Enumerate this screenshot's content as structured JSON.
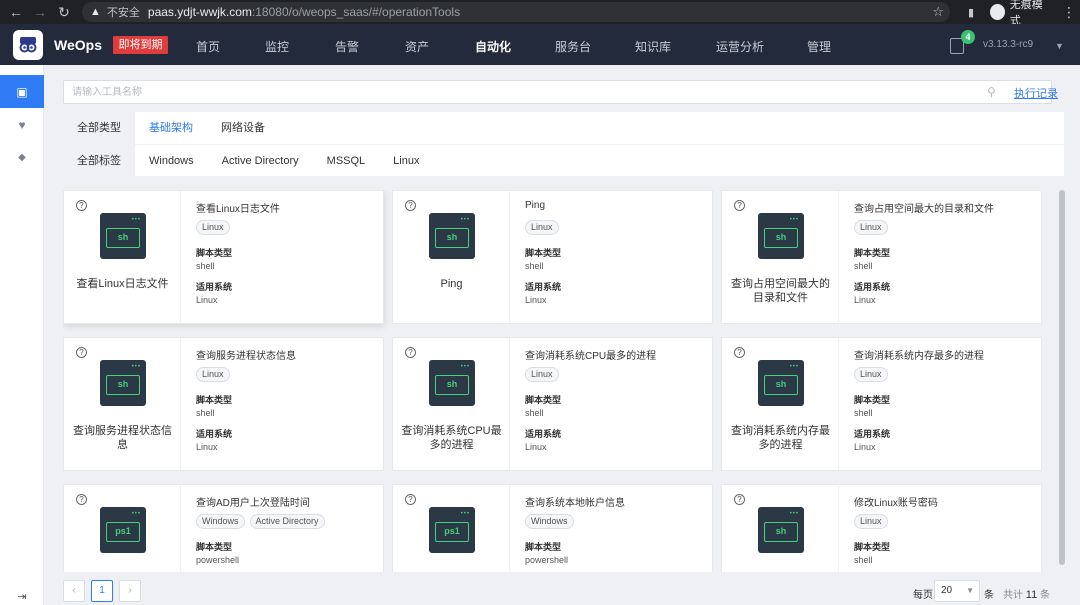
{
  "browser": {
    "back_icon": "arrow-left-icon",
    "forward_icon": "arrow-right-icon",
    "reload_icon": "reload-icon",
    "insecure_label": "不安全",
    "url_host": "paas.ydjt-wwjk.com",
    "url_path": ":18080/o/weops_saas/#/operationTools",
    "incognito_label": "无痕模式"
  },
  "header": {
    "brand": "WeOps",
    "expire_badge": "即将到期",
    "nav": [
      "首页",
      "监控",
      "告警",
      "资产",
      "自动化",
      "服务台",
      "知识库",
      "运营分析",
      "管理"
    ],
    "active_nav": "自动化",
    "notification_count": "4",
    "version": "v3.13.3-rc9"
  },
  "search": {
    "placeholder": "请输入工具名称",
    "exec_record": "执行记录"
  },
  "types": {
    "all": "全部类型",
    "items": [
      "基础架构",
      "网络设备"
    ],
    "selected": "基础架构"
  },
  "labels": {
    "all": "全部标签",
    "items": [
      "Windows",
      "Active Directory",
      "MSSQL",
      "Linux"
    ]
  },
  "meta_labels": {
    "script_type": "脚本类型",
    "os": "适用系统"
  },
  "tools": [
    {
      "caption": "查看Linux日志文件",
      "title": "查看Linux日志文件",
      "icon": "sh",
      "tags": [
        "Linux"
      ],
      "script_type": "shell",
      "os": "Linux"
    },
    {
      "caption": "Ping",
      "title": "Ping",
      "icon": "sh",
      "tags": [
        "Linux"
      ],
      "script_type": "shell",
      "os": "Linux"
    },
    {
      "caption": "查询占用空间最大的目录和文件",
      "title": "查询占用空间最大的目录和文件",
      "icon": "sh",
      "tags": [
        "Linux"
      ],
      "script_type": "shell",
      "os": "Linux"
    },
    {
      "caption": "查询服务进程状态信息",
      "title": "查询服务进程状态信息",
      "icon": "sh",
      "tags": [
        "Linux"
      ],
      "script_type": "shell",
      "os": "Linux"
    },
    {
      "caption": "查询消耗系统CPU最多的进程",
      "title": "查询消耗系统CPU最多的进程",
      "icon": "sh",
      "tags": [
        "Linux"
      ],
      "script_type": "shell",
      "os": "Linux"
    },
    {
      "caption": "查询消耗系统内存最多的进程",
      "title": "查询消耗系统内存最多的进程",
      "icon": "sh",
      "tags": [
        "Linux"
      ],
      "script_type": "shell",
      "os": "Linux"
    },
    {
      "caption": "",
      "title": "查询AD用户上次登陆时间",
      "icon": "ps1",
      "tags": [
        "Windows",
        "Active Directory"
      ],
      "script_type": "powershell",
      "os": ""
    },
    {
      "caption": "",
      "title": "查询系统本地帐户信息",
      "icon": "ps1",
      "tags": [
        "Windows"
      ],
      "script_type": "powershell",
      "os": ""
    },
    {
      "caption": "",
      "title": "修改Linux账号密码",
      "icon": "sh",
      "tags": [
        "Linux"
      ],
      "script_type": "shell",
      "os": ""
    }
  ],
  "pagination": {
    "prev": "‹",
    "current": "1",
    "next": "›",
    "per_page_label": "每页",
    "per_page": "20",
    "unit": "条",
    "total_prefix": "共计",
    "total": "11",
    "total_suffix": "条"
  }
}
